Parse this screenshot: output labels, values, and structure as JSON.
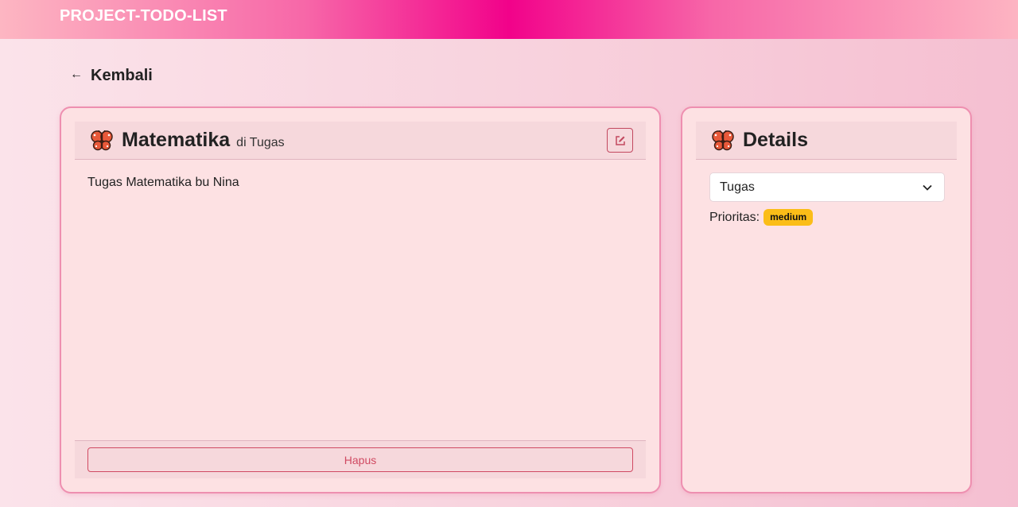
{
  "navbar": {
    "brand": "PROJECT-TODO-LIST"
  },
  "back": {
    "arrow": "←",
    "label": "Kembali"
  },
  "task": {
    "title": "Matematika",
    "subtitle": "di Tugas",
    "description": "Tugas Matematika bu Nina",
    "delete_label": "Hapus",
    "icon": "butterfly-icon",
    "edit_icon": "edit-icon"
  },
  "details": {
    "title": "Details",
    "icon": "butterfly-icon",
    "category_selected": "Tugas",
    "priority_label": "Prioritas:",
    "priority_value": "medium"
  },
  "colors": {
    "accent_pink": "#f2028a",
    "card_border": "#ee8fb0",
    "danger": "#d04a62",
    "badge_yellow": "#fbbd18"
  }
}
